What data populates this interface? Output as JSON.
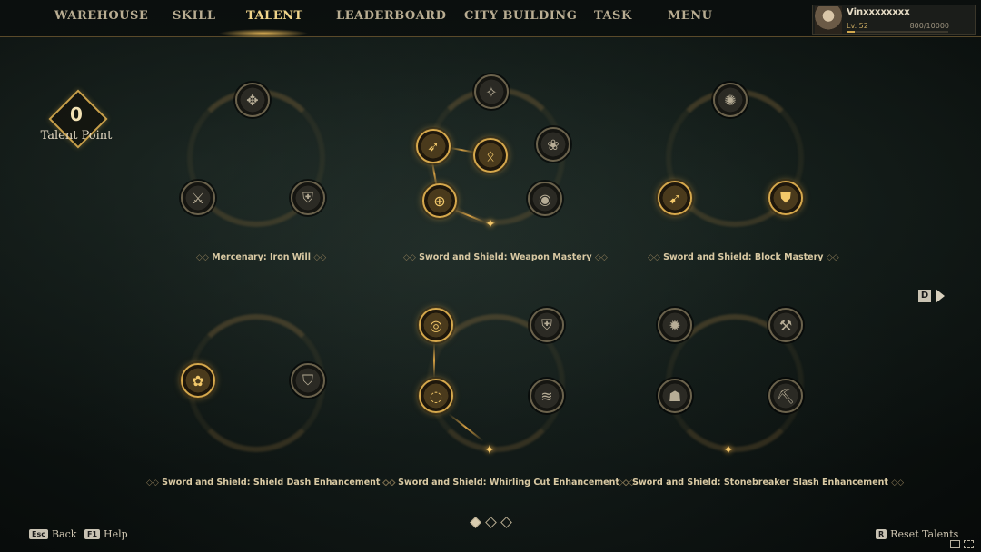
{
  "nav": {
    "items": [
      {
        "label": "WAREHOUSE",
        "active": false
      },
      {
        "label": "SKILL",
        "active": false
      },
      {
        "label": "TALENT",
        "active": true
      },
      {
        "label": "LEADERBOARD",
        "active": false
      },
      {
        "label": "CITY BUILDING",
        "active": false
      },
      {
        "label": "TASK",
        "active": false
      },
      {
        "label": "MENU",
        "active": false
      }
    ]
  },
  "profile": {
    "name": "Vinxxxxxxxx",
    "level": "Lv. 52",
    "exp": "800/10000",
    "exp_fraction": 0.08
  },
  "talent_point": {
    "value": "0",
    "label": "Talent Point"
  },
  "trees": [
    {
      "name": "Mercenary: Iron Will",
      "icons": [
        "claw-slash-icon",
        "muscle-armor-icon",
        "fist-shield-icon"
      ]
    },
    {
      "name": "Sword and Shield: Weapon Mastery",
      "icons": [
        "spear-burst-icon",
        "sword-arc-icon",
        "claw-bloom-icon",
        "blade-rune-icon",
        "sword-circle-icon",
        "orb-shield-icon"
      ]
    },
    {
      "name": "Sword and Shield: Block Mastery",
      "icons": [
        "spiral-shield-icon",
        "dash-shield-icon",
        "fist-guard-icon"
      ]
    },
    {
      "name": "Sword and Shield: Shield Dash Enhancement",
      "icons": [
        "rune-orb-icon",
        "helm-shield-icon"
      ]
    },
    {
      "name": "Sword and Shield: Whirling Cut Enhancement",
      "icons": [
        "whirl-ring-icon",
        "shield-slash-icon",
        "whirl-blade-icon",
        "twin-slash-icon"
      ]
    },
    {
      "name": "Sword and Shield: Stonebreaker Slash Enhancement",
      "icons": [
        "stone-burst-icon",
        "hammer-strike-icon",
        "rock-slash-icon",
        "crack-shield-icon"
      ]
    }
  ],
  "pager": {
    "pages": 3,
    "current": 1
  },
  "next_key": "D",
  "footer": {
    "back_key": "Esc",
    "back_label": "Back",
    "help_key": "F1",
    "help_label": "Help",
    "reset_key": "R",
    "reset_label": "Reset Talents"
  }
}
